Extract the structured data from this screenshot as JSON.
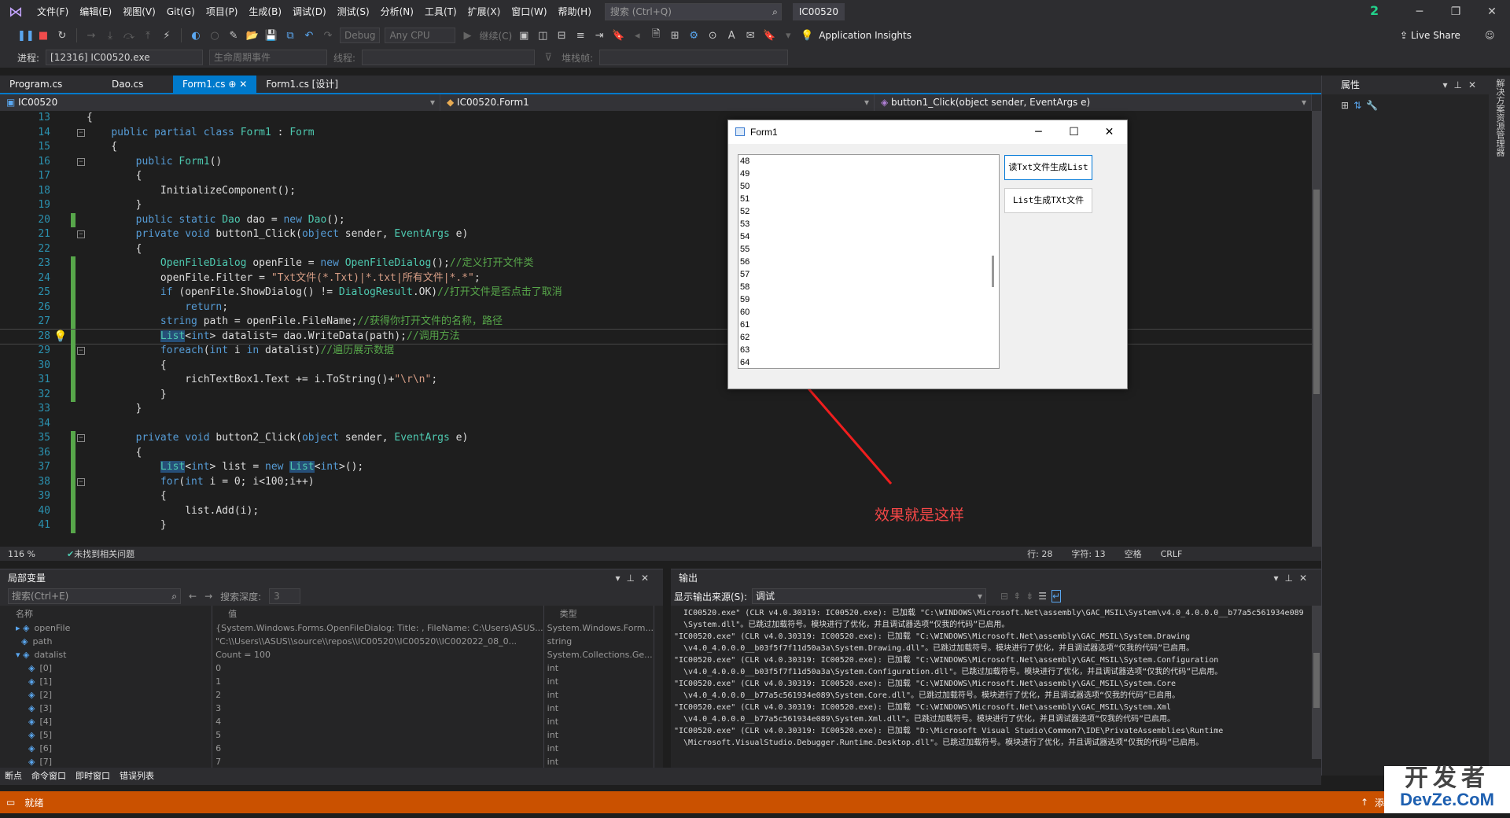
{
  "menu": [
    "文件(F)",
    "编辑(E)",
    "视图(V)",
    "Git(G)",
    "项目(P)",
    "生成(B)",
    "调试(D)",
    "测试(S)",
    "分析(N)",
    "工具(T)",
    "扩展(X)",
    "窗口(W)",
    "帮助(H)"
  ],
  "search": {
    "placeholder": "搜索 (Ctrl+Q)"
  },
  "solution_name": "IC00520",
  "notification_count": "2",
  "toolbar": {
    "config": "Debug",
    "platform": "Any CPU",
    "continue": "继续(C)",
    "app_insights": "Application Insights",
    "live_share": "Live Share"
  },
  "toolbar2": {
    "process_label": "进程:",
    "process_value": "[12316] IC00520.exe",
    "lifecycle": "生命周期事件",
    "thread_label": "线程:",
    "stack_label": "堆栈帧:"
  },
  "doc_tabs": [
    "Program.cs",
    "Dao.cs",
    "Form1.cs",
    "Form1.cs [设计]"
  ],
  "nav": {
    "project": "IC00520",
    "class": "IC00520.Form1",
    "member": "button1_Click(object sender, EventArgs e)"
  },
  "editor_status": {
    "zoom": "116 %",
    "issues": "未找到相关问题",
    "row": "行: 28",
    "col": "字符: 13",
    "ws": "空格",
    "eol": "CRLF"
  },
  "form1": {
    "title": "Form1",
    "lines": [
      "48",
      "49",
      "50",
      "51",
      "52",
      "53",
      "54",
      "55",
      "56",
      "57",
      "58",
      "59",
      "60",
      "61",
      "62",
      "63",
      "64"
    ],
    "button1": "读Txt文件生成List",
    "button2": "List生成TXt文件"
  },
  "annotation": "效果就是这样",
  "properties": {
    "title": "属性",
    "side_strip": "解决方案资源管理器"
  },
  "locals": {
    "title": "局部变量",
    "search_placeholder": "搜索(Ctrl+E)",
    "depth_label": "搜索深度:",
    "depth_value": "3",
    "headers": [
      "名称",
      "值",
      "类型"
    ],
    "rows": [
      {
        "name": "openFile",
        "value": "{System.Windows.Forms.OpenFileDialog: Title: , FileName: C:\\Users\\ASUS...",
        "type": "System.Windows.Form..."
      },
      {
        "name": "path",
        "value": "\"C:\\\\Users\\\\ASUS\\\\source\\\\repos\\\\IC00520\\\\IC00520\\\\IC002022_08_0...",
        "type": "string"
      },
      {
        "name": "datalist",
        "value": "Count = 100",
        "type": "System.Collections.Ge..."
      },
      {
        "name": "[0]",
        "value": "0",
        "type": "int"
      },
      {
        "name": "[1]",
        "value": "1",
        "type": "int"
      },
      {
        "name": "[2]",
        "value": "2",
        "type": "int"
      },
      {
        "name": "[3]",
        "value": "3",
        "type": "int"
      },
      {
        "name": "[4]",
        "value": "4",
        "type": "int"
      },
      {
        "name": "[5]",
        "value": "5",
        "type": "int"
      },
      {
        "name": "[6]",
        "value": "6",
        "type": "int"
      },
      {
        "name": "[7]",
        "value": "7",
        "type": "int"
      }
    ]
  },
  "output": {
    "title": "输出",
    "source_label": "显示输出来源(S):",
    "source_value": "调试",
    "log": "  IC00520.exe\" (CLR v4.0.30319: IC00520.exe): 已加载 \"C:\\WINDOWS\\Microsoft.Net\\assembly\\GAC_MSIL\\System\\v4.0_4.0.0.0__b77a5c561934e089\n  \\System.dll\"。已跳过加载符号。模块进行了优化，并且调试器选项“仅我的代码”已启用。\n\"IC00520.exe\" (CLR v4.0.30319: IC00520.exe): 已加载 \"C:\\WINDOWS\\Microsoft.Net\\assembly\\GAC_MSIL\\System.Drawing\n  \\v4.0_4.0.0.0__b03f5f7f11d50a3a\\System.Drawing.dll\"。已跳过加载符号。模块进行了优化，并且调试器选项“仅我的代码”已启用。\n\"IC00520.exe\" (CLR v4.0.30319: IC00520.exe): 已加载 \"C:\\WINDOWS\\Microsoft.Net\\assembly\\GAC_MSIL\\System.Configuration\n  \\v4.0_4.0.0.0__b03f5f7f11d50a3a\\System.Configuration.dll\"。已跳过加载符号。模块进行了优化，并且调试器选项“仅我的代码”已启用。\n\"IC00520.exe\" (CLR v4.0.30319: IC00520.exe): 已加载 \"C:\\WINDOWS\\Microsoft.Net\\assembly\\GAC_MSIL\\System.Core\n  \\v4.0_4.0.0.0__b77a5c561934e089\\System.Core.dll\"。已跳过加载符号。模块进行了优化，并且调试器选项“仅我的代码”已启用。\n\"IC00520.exe\" (CLR v4.0.30319: IC00520.exe): 已加载 \"C:\\WINDOWS\\Microsoft.Net\\assembly\\GAC_MSIL\\System.Xml\n  \\v4.0_4.0.0.0__b77a5c561934e089\\System.Xml.dll\"。已跳过加载符号。模块进行了优化，并且调试器选项“仅我的代码”已启用。\n\"IC00520.exe\" (CLR v4.0.30319: IC00520.exe): 已加载 \"D:\\Microsoft Visual Studio\\Common7\\IDE\\PrivateAssemblies\\Runtime\n  \\Microsoft.VisualStudio.Debugger.Runtime.Desktop.dll\"。已跳过加载符号。模块进行了优化，并且调试器选项“仅我的代码”已启用。"
  },
  "bottom_tabs": [
    "断点",
    "命令窗口",
    "即时窗口",
    "错误列表"
  ],
  "status": {
    "ready": "就绪",
    "add": "添"
  },
  "watermark": {
    "line1": "开发者",
    "line2": "DevZe.CoM"
  },
  "code": [
    {
      "n": "13",
      "t": "{"
    },
    {
      "n": "14",
      "t": "    public partial class Form1 : Form"
    },
    {
      "n": "15",
      "t": "    {"
    },
    {
      "n": "16",
      "t": "        public Form1()"
    },
    {
      "n": "17",
      "t": "        {"
    },
    {
      "n": "18",
      "t": "            InitializeComponent();"
    },
    {
      "n": "19",
      "t": "        }"
    },
    {
      "n": "20",
      "t": "        public static Dao dao = new Dao();"
    },
    {
      "n": "21",
      "t": "        private void button1_Click(object sender, EventArgs e)"
    },
    {
      "n": "22",
      "t": "        {"
    },
    {
      "n": "23",
      "t": "            OpenFileDialog openFile = new OpenFileDialog();//定义打开文件类"
    },
    {
      "n": "24",
      "t": "            openFile.Filter = \"Txt文件(*.Txt)|*.txt|所有文件|*.*\";"
    },
    {
      "n": "25",
      "t": "            if (openFile.ShowDialog() != DialogResult.OK)//打开文件是否点击了取消"
    },
    {
      "n": "26",
      "t": "                return;"
    },
    {
      "n": "27",
      "t": "            string path = openFile.FileName;//获得你打开文件的名称，路径"
    },
    {
      "n": "28",
      "t": "            List<int> datalist= dao.WriteData(path);//调用方法"
    },
    {
      "n": "29",
      "t": "            foreach(int i in datalist)//遍历展示数据"
    },
    {
      "n": "30",
      "t": "            {"
    },
    {
      "n": "31",
      "t": "                richTextBox1.Text += i.ToString()+\"\\r\\n\";"
    },
    {
      "n": "32",
      "t": "            }"
    },
    {
      "n": "33",
      "t": "        }"
    },
    {
      "n": "34",
      "t": ""
    },
    {
      "n": "35",
      "t": "        private void button2_Click(object sender, EventArgs e)"
    },
    {
      "n": "36",
      "t": "        {"
    },
    {
      "n": "37",
      "t": "            List<int> list = new List<int>();"
    },
    {
      "n": "38",
      "t": "            for(int i = 0; i<100;i++)"
    },
    {
      "n": "39",
      "t": "            {"
    },
    {
      "n": "40",
      "t": "                list.Add(i);"
    },
    {
      "n": "41",
      "t": "            }"
    }
  ]
}
